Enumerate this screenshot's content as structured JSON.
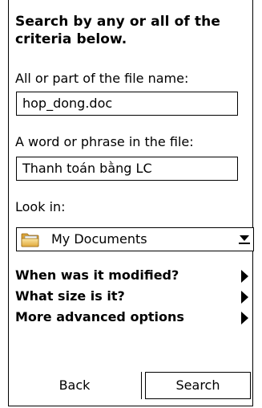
{
  "heading": "Search by any or all of the criteria below.",
  "file_name": {
    "label": "All or part of the file name:",
    "value": "hop_dong.doc"
  },
  "phrase": {
    "label": "A word or phrase in the file:",
    "value": "Thanh toán bằng LC"
  },
  "look_in": {
    "label": "Look in:",
    "value": "My Documents",
    "icon": "folder-icon"
  },
  "options": [
    {
      "label": "When was it modified?",
      "icon": "arrow-right-icon"
    },
    {
      "label": "What size is it?",
      "icon": "arrow-right-icon"
    },
    {
      "label": "More advanced options",
      "icon": "arrow-right-icon"
    }
  ],
  "buttons": {
    "back": "Back",
    "search": "Search"
  }
}
